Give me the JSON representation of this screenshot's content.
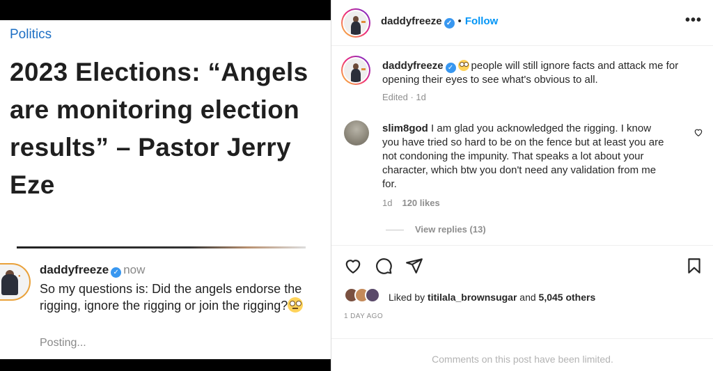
{
  "article": {
    "category": "Politics",
    "headline": "2023 Elections: “Angels are monitoring election results” – Pastor Jerry Eze"
  },
  "reply_preview": {
    "username": "daddyfreeze",
    "time": "now",
    "text": "So my questions is: Did the angels endorse the rigging, ignore the rigging or join the rigging?",
    "status": "Posting..."
  },
  "post": {
    "header": {
      "username": "daddyfreeze",
      "follow_label": "Follow",
      "more_label": "•••"
    },
    "caption": {
      "username": "daddyfreeze",
      "text": "people will still ignore facts and attack me for opening their eyes to see what's obvious to all.",
      "meta": "Edited · 1d"
    },
    "comment": {
      "username": "slim8god",
      "text": "I am glad you acknowledged the rigging. I know you have tried so hard to be on the fence but at least you are not condoning the impunity. That speaks a lot about your character, which btw you don't need any validation from me for.",
      "age": "1d",
      "likes": "120 likes",
      "view_replies": "View replies (13)"
    },
    "liked_by": {
      "prefix": "Liked by",
      "user": "titilala_brownsugar",
      "and": "and",
      "others": "5,045 others"
    },
    "date": "1 DAY AGO",
    "limited_notice": "Comments on this post have been limited."
  },
  "icons": {
    "like": "heart-icon",
    "comment": "comment-icon",
    "share": "send-icon",
    "save": "bookmark-icon",
    "verified": "verified-badge-icon"
  },
  "colors": {
    "accent": "#0095f6",
    "verified": "#3897f0",
    "category": "#1d6fc4"
  }
}
